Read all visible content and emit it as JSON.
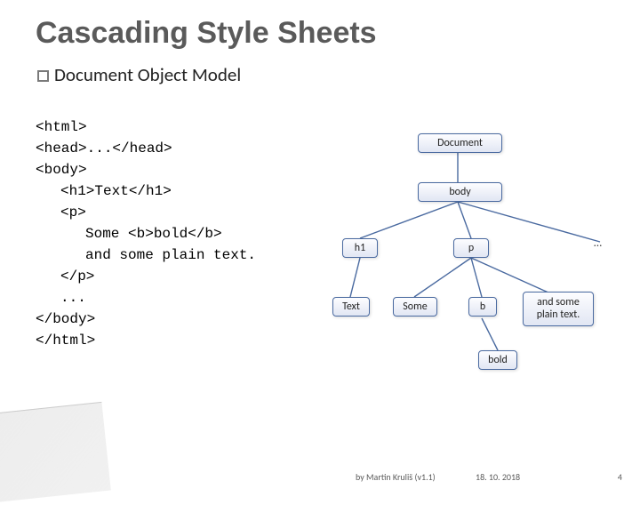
{
  "title": "Cascading Style Sheets",
  "subhead_prefix": "Document",
  "subhead_rest": " Object Model",
  "code": {
    "l1": "<html>",
    "l2": "<head>...</head>",
    "l3": "<body>",
    "l4": "<h1>Text</h1>",
    "l5": "<p>",
    "l6": "Some <b>bold</b>",
    "l7": "and some plain text.",
    "l8": "</p>",
    "l9": "...",
    "l10": "</body>",
    "l11": "</html>"
  },
  "tree": {
    "document": "Document",
    "body": "body",
    "h1": "h1",
    "p": "p",
    "ellipsis_branch": "…",
    "text": "Text",
    "some": "Some",
    "b": "b",
    "plain": "and some\nplain text.",
    "bold": "bold"
  },
  "footer": {
    "author": "by Martin Kruliš (v1.1)",
    "date": "18. 10. 2018",
    "page": "4"
  }
}
